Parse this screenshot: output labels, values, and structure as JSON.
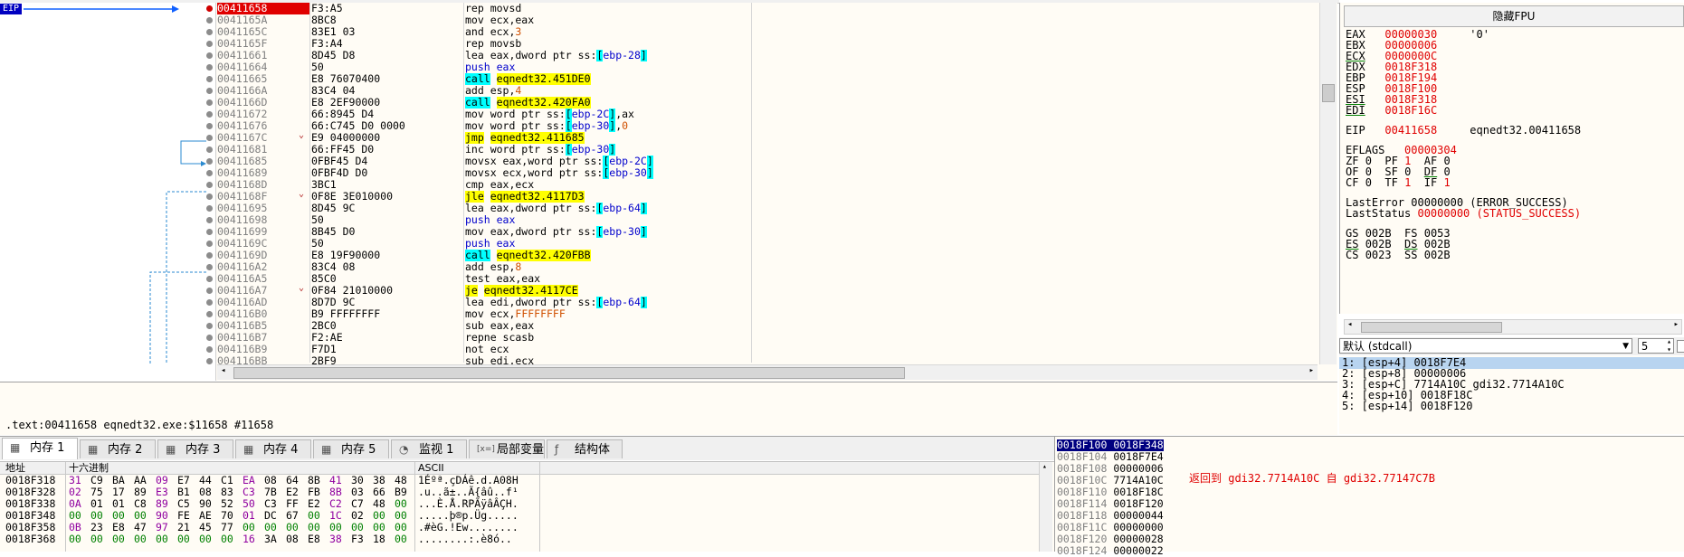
{
  "cpu": {
    "eip_label": "EIP",
    "rows": [
      {
        "addr": "00411658",
        "bytes": "F3:A5",
        "instr": [
          {
            "t": "rep movsd"
          }
        ],
        "current": true
      },
      {
        "addr": "0041165A",
        "bytes": "8BC8",
        "instr": [
          {
            "t": "mov ecx,eax"
          }
        ]
      },
      {
        "addr": "0041165C",
        "bytes": "83E1 03",
        "instr": [
          {
            "t": "and ecx,"
          },
          {
            "t": "3",
            "c": "num-o"
          }
        ]
      },
      {
        "addr": "0041165F",
        "bytes": "F3:A4",
        "instr": [
          {
            "t": "rep movsb"
          }
        ]
      },
      {
        "addr": "00411661",
        "bytes": "8D45 D8",
        "instr": [
          {
            "t": "lea eax,dword ptr ss:"
          },
          {
            "t": "[",
            "c": "hl-c"
          },
          {
            "t": "ebp-28",
            "c": "mem"
          },
          {
            "t": "]",
            "c": "hl-c"
          }
        ]
      },
      {
        "addr": "00411664",
        "bytes": "50",
        "instr": [
          {
            "t": "push eax",
            "c": "mem"
          }
        ]
      },
      {
        "addr": "00411665",
        "bytes": "E8 76070400",
        "instr": [
          {
            "t": "call",
            "c": "hl-c"
          },
          {
            "t": " "
          },
          {
            "t": "eqnedt32.451DE0",
            "c": "hl-y"
          }
        ]
      },
      {
        "addr": "0041166A",
        "bytes": "83C4 04",
        "instr": [
          {
            "t": "add esp,"
          },
          {
            "t": "4",
            "c": "num-o"
          }
        ]
      },
      {
        "addr": "0041166D",
        "bytes": "E8 2EF90000",
        "instr": [
          {
            "t": "call",
            "c": "hl-c"
          },
          {
            "t": " "
          },
          {
            "t": "eqnedt32.420FA0",
            "c": "hl-y"
          }
        ]
      },
      {
        "addr": "00411672",
        "bytes": "66:8945 D4",
        "instr": [
          {
            "t": "mov word ptr ss:"
          },
          {
            "t": "[",
            "c": "hl-c"
          },
          {
            "t": "ebp-2C",
            "c": "mem"
          },
          {
            "t": "]",
            "c": "hl-c"
          },
          {
            "t": ",ax"
          }
        ]
      },
      {
        "addr": "00411676",
        "bytes": "66:C745 D0 0000",
        "instr": [
          {
            "t": "mov word ptr ss:"
          },
          {
            "t": "[",
            "c": "hl-c"
          },
          {
            "t": "ebp-30",
            "c": "mem"
          },
          {
            "t": "]",
            "c": "hl-c"
          },
          {
            "t": ","
          },
          {
            "t": "0",
            "c": "num-o"
          }
        ]
      },
      {
        "addr": "0041167C",
        "bytes": "E9 04000000",
        "instr": [
          {
            "t": "jmp",
            "c": "hl-y"
          },
          {
            "t": " "
          },
          {
            "t": "eqnedt32.411685",
            "c": "hl-y"
          }
        ],
        "arrow": true
      },
      {
        "addr": "00411681",
        "bytes": "66:FF45 D0",
        "instr": [
          {
            "t": "inc word ptr ss:"
          },
          {
            "t": "[",
            "c": "hl-c"
          },
          {
            "t": "ebp-30",
            "c": "mem"
          },
          {
            "t": "]",
            "c": "hl-c"
          }
        ]
      },
      {
        "addr": "00411685",
        "bytes": "0FBF45 D4",
        "instr": [
          {
            "t": "movsx eax,word ptr ss:"
          },
          {
            "t": "[",
            "c": "hl-c"
          },
          {
            "t": "ebp-2C",
            "c": "mem"
          },
          {
            "t": "]",
            "c": "hl-c"
          }
        ]
      },
      {
        "addr": "00411689",
        "bytes": "0FBF4D D0",
        "instr": [
          {
            "t": "movsx ecx,word ptr ss:"
          },
          {
            "t": "[",
            "c": "hl-c"
          },
          {
            "t": "ebp-30",
            "c": "mem"
          },
          {
            "t": "]",
            "c": "hl-c"
          }
        ]
      },
      {
        "addr": "0041168D",
        "bytes": "3BC1",
        "instr": [
          {
            "t": "cmp eax,ecx"
          }
        ]
      },
      {
        "addr": "0041168F",
        "bytes": "0F8E 3E010000",
        "instr": [
          {
            "t": "jle",
            "c": "hl-y"
          },
          {
            "t": " "
          },
          {
            "t": "eqnedt32.4117D3",
            "c": "hl-y"
          }
        ],
        "arrow": true
      },
      {
        "addr": "00411695",
        "bytes": "8D45 9C",
        "instr": [
          {
            "t": "lea eax,dword ptr ss:"
          },
          {
            "t": "[",
            "c": "hl-c"
          },
          {
            "t": "ebp-64",
            "c": "mem"
          },
          {
            "t": "]",
            "c": "hl-c"
          }
        ]
      },
      {
        "addr": "00411698",
        "bytes": "50",
        "instr": [
          {
            "t": "push eax",
            "c": "mem"
          }
        ]
      },
      {
        "addr": "00411699",
        "bytes": "8B45 D0",
        "instr": [
          {
            "t": "mov eax,dword ptr ss:"
          },
          {
            "t": "[",
            "c": "hl-c"
          },
          {
            "t": "ebp-30",
            "c": "mem"
          },
          {
            "t": "]",
            "c": "hl-c"
          }
        ]
      },
      {
        "addr": "0041169C",
        "bytes": "50",
        "instr": [
          {
            "t": "push eax",
            "c": "mem"
          }
        ]
      },
      {
        "addr": "0041169D",
        "bytes": "E8 19F90000",
        "instr": [
          {
            "t": "call",
            "c": "hl-c"
          },
          {
            "t": " "
          },
          {
            "t": "eqnedt32.420FBB",
            "c": "hl-y"
          }
        ]
      },
      {
        "addr": "004116A2",
        "bytes": "83C4 08",
        "instr": [
          {
            "t": "add esp,"
          },
          {
            "t": "8",
            "c": "num-o"
          }
        ]
      },
      {
        "addr": "004116A5",
        "bytes": "85C0",
        "instr": [
          {
            "t": "test eax,eax"
          }
        ]
      },
      {
        "addr": "004116A7",
        "bytes": "0F84 21010000",
        "instr": [
          {
            "t": "je",
            "c": "hl-y"
          },
          {
            "t": " "
          },
          {
            "t": "eqnedt32.4117CE",
            "c": "hl-y"
          }
        ],
        "arrow": true
      },
      {
        "addr": "004116AD",
        "bytes": "8D7D 9C",
        "instr": [
          {
            "t": "lea edi,dword ptr ss:"
          },
          {
            "t": "[",
            "c": "hl-c"
          },
          {
            "t": "ebp-64",
            "c": "mem"
          },
          {
            "t": "]",
            "c": "hl-c"
          }
        ]
      },
      {
        "addr": "004116B0",
        "bytes": "B9 FFFFFFFF",
        "instr": [
          {
            "t": "mov ecx,"
          },
          {
            "t": "FFFFFFFF",
            "c": "num-o"
          }
        ]
      },
      {
        "addr": "004116B5",
        "bytes": "2BC0",
        "instr": [
          {
            "t": "sub eax,eax"
          }
        ]
      },
      {
        "addr": "004116B7",
        "bytes": "F2:AE",
        "instr": [
          {
            "t": "repne scasb"
          }
        ]
      },
      {
        "addr": "004116B9",
        "bytes": "F7D1",
        "instr": [
          {
            "t": "not ecx"
          }
        ]
      },
      {
        "addr": "004116BB",
        "bytes": "2BF9",
        "instr": [
          {
            "t": "sub edi,ecx"
          }
        ]
      }
    ]
  },
  "info": {
    "text": ".text:00411658 eqnedt32.exe:$11658 #11658"
  },
  "registers": {
    "fpu_button": "隐藏FPU",
    "gpr": [
      {
        "name": "EAX",
        "value": "00000030",
        "extra": "'0'",
        "u": false
      },
      {
        "name": "EBX",
        "value": "00000006",
        "extra": "",
        "u": false
      },
      {
        "name": "ECX",
        "value": "0000000C",
        "extra": "",
        "u": true
      },
      {
        "name": "EDX",
        "value": "0018F318",
        "extra": "",
        "u": false
      },
      {
        "name": "EBP",
        "value": "0018F194",
        "extra": "",
        "u": false
      },
      {
        "name": "ESP",
        "value": "0018F100",
        "extra": "",
        "u": false
      },
      {
        "name": "ESI",
        "value": "0018F318",
        "extra": "",
        "u": true
      },
      {
        "name": "EDI",
        "value": "0018F16C",
        "extra": "",
        "u": true
      }
    ],
    "eip": {
      "name": "EIP",
      "value": "00411658",
      "extra": "eqnedt32.00411658"
    },
    "eflags": {
      "name": "EFLAGS",
      "value": "00000304"
    },
    "flags_rows": [
      [
        {
          "n": "ZF",
          "v": "0"
        },
        {
          "n": "PF",
          "v": "1"
        },
        {
          "n": "AF",
          "v": "0"
        }
      ],
      [
        {
          "n": "OF",
          "v": "0"
        },
        {
          "n": "SF",
          "v": "0"
        },
        {
          "n": "DF",
          "v": "0"
        }
      ],
      [
        {
          "n": "CF",
          "v": "0"
        },
        {
          "n": "TF",
          "v": "1"
        },
        {
          "n": "IF",
          "v": "1"
        }
      ]
    ],
    "last_error": {
      "label": "LastError",
      "value": "00000000",
      "desc": "(ERROR_SUCCESS)"
    },
    "last_status": {
      "label": "LastStatus",
      "value": "00000000",
      "desc": "(STATUS_SUCCESS)"
    },
    "segs": [
      [
        {
          "n": "GS",
          "v": "002B"
        },
        {
          "n": "FS",
          "v": "0053"
        }
      ],
      [
        {
          "n": "ES",
          "v": "002B"
        },
        {
          "n": "DS",
          "v": "002B"
        }
      ],
      [
        {
          "n": "CS",
          "v": "0023"
        },
        {
          "n": "SS",
          "v": "002B"
        }
      ]
    ]
  },
  "callconv": {
    "selected": "默认 (stdcall)",
    "count": "5"
  },
  "args": [
    "1: [esp+4] 0018F7E4",
    "2: [esp+8] 00000006",
    "3: [esp+C] 7714A10C gdi32.7714A10C",
    "4: [esp+10] 0018F18C",
    "5: [esp+14] 0018F120"
  ],
  "tabs": [
    {
      "label": "内存 1",
      "icon": "memory-icon",
      "active": true
    },
    {
      "label": "内存 2",
      "icon": "memory-icon"
    },
    {
      "label": "内存 3",
      "icon": "memory-icon"
    },
    {
      "label": "内存 4",
      "icon": "memory-icon"
    },
    {
      "label": "内存 5",
      "icon": "memory-icon"
    },
    {
      "label": "监视 1",
      "icon": "watch-icon"
    },
    {
      "label": "局部变量",
      "icon": "locals-icon",
      "prefix": "[x=]"
    },
    {
      "label": "结构体",
      "icon": "struct-icon"
    }
  ],
  "dump": {
    "header": {
      "addr": "地址",
      "hex": "十六进制",
      "ascii": "ASCII"
    },
    "rows": [
      {
        "addr": "0018F318",
        "hex": [
          "31",
          "C9",
          "BA",
          "AA",
          "09",
          "E7",
          "44",
          "C1",
          "EA",
          "08",
          "64",
          "8B",
          "41",
          "30",
          "38",
          "48"
        ],
        "ascii": "1Éºª.çDÁê.d.A08H"
      },
      {
        "addr": "0018F328",
        "hex": [
          "02",
          "75",
          "17",
          "89",
          "E3",
          "B1",
          "08",
          "83",
          "C3",
          "7B",
          "E2",
          "FB",
          "8B",
          "03",
          "66",
          "B9"
        ],
        "ascii": ".u..ã±..Ã{âû..f¹"
      },
      {
        "addr": "0018F338",
        "hex": [
          "0A",
          "01",
          "01",
          "C8",
          "89",
          "C5",
          "90",
          "52",
          "50",
          "C3",
          "FF",
          "E2",
          "C2",
          "C7",
          "48",
          "00"
        ],
        "ascii": "...È.Å.RPÃÿâÂÇH."
      },
      {
        "addr": "0018F348",
        "hex": [
          "00",
          "00",
          "00",
          "00",
          "90",
          "FE",
          "AE",
          "70",
          "01",
          "DC",
          "67",
          "00",
          "1C",
          "02",
          "00",
          "00"
        ],
        "ascii": ".....þ®p.Üg....."
      },
      {
        "addr": "0018F358",
        "hex": [
          "0B",
          "23",
          "E8",
          "47",
          "97",
          "21",
          "45",
          "77",
          "00",
          "00",
          "00",
          "00",
          "00",
          "00",
          "00",
          "00"
        ],
        "ascii": ".#èG.!Ew........"
      },
      {
        "addr": "0018F368",
        "hex": [
          "00",
          "00",
          "00",
          "00",
          "00",
          "00",
          "00",
          "00",
          "16",
          "3A",
          "08",
          "E8",
          "38",
          "F3",
          "18",
          "00"
        ],
        "ascii": "........:.è8ó.."
      }
    ]
  },
  "stack": {
    "rows": [
      {
        "addr": "0018F100",
        "val": "0018F348",
        "sel": true
      },
      {
        "addr": "0018F104",
        "val": "0018F7E4"
      },
      {
        "addr": "0018F108",
        "val": "00000006"
      },
      {
        "addr": "0018F10C",
        "val": "7714A10C"
      },
      {
        "addr": "0018F110",
        "val": "0018F18C"
      },
      {
        "addr": "0018F114",
        "val": "0018F120"
      },
      {
        "addr": "0018F118",
        "val": "00000044"
      },
      {
        "addr": "0018F11C",
        "val": "00000000"
      },
      {
        "addr": "0018F120",
        "val": "00000028"
      },
      {
        "addr": "0018F124",
        "val": "00000022"
      }
    ],
    "comment": "返回到 gdi32.7714A10C 自 gdi32.77147C7B"
  },
  "colors": {
    "accent_red": "#e00000",
    "highlight_yellow": "#ffff00",
    "highlight_cyan": "#00ffff",
    "selection_navy": "#000080"
  }
}
